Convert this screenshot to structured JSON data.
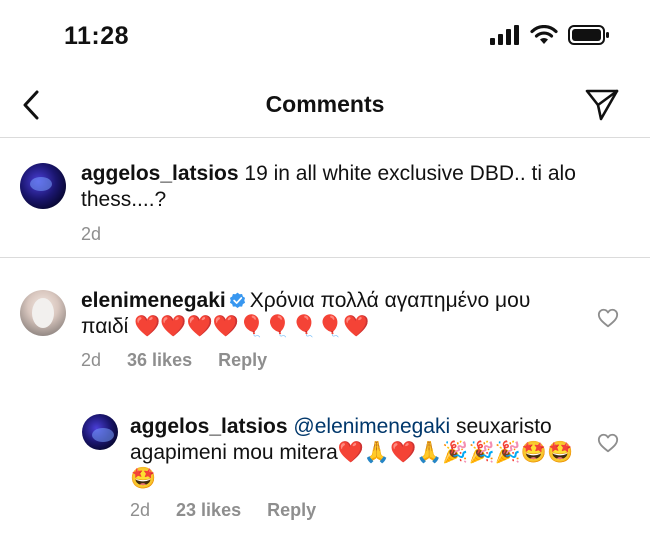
{
  "status_bar": {
    "time": "11:28"
  },
  "header": {
    "title": "Comments"
  },
  "caption": {
    "username": "aggelos_latsios",
    "text": "19 in all white exclusive DBD.. ti alo thess....?",
    "time": "2d"
  },
  "comments": [
    {
      "username": "elenimenegaki",
      "verified": true,
      "text": "Χρόνια πολλά αγαπημένο μου παιδί ❤️❤️❤️❤️🎈🎈🎈🎈❤️",
      "time": "2d",
      "likes": "36 likes",
      "reply": "Reply"
    },
    {
      "username": "aggelos_latsios",
      "mention": "@elenimenegaki",
      "text": "seuxaristo agapimeni mou mitera❤️🙏❤️🙏🎉🎉🎉🤩🤩🤩",
      "time": "2d",
      "likes": "23 likes",
      "reply": "Reply"
    }
  ],
  "colors": {
    "mention": "#00376b",
    "meta": "#8e8e8e",
    "verified": "#3897f0"
  }
}
